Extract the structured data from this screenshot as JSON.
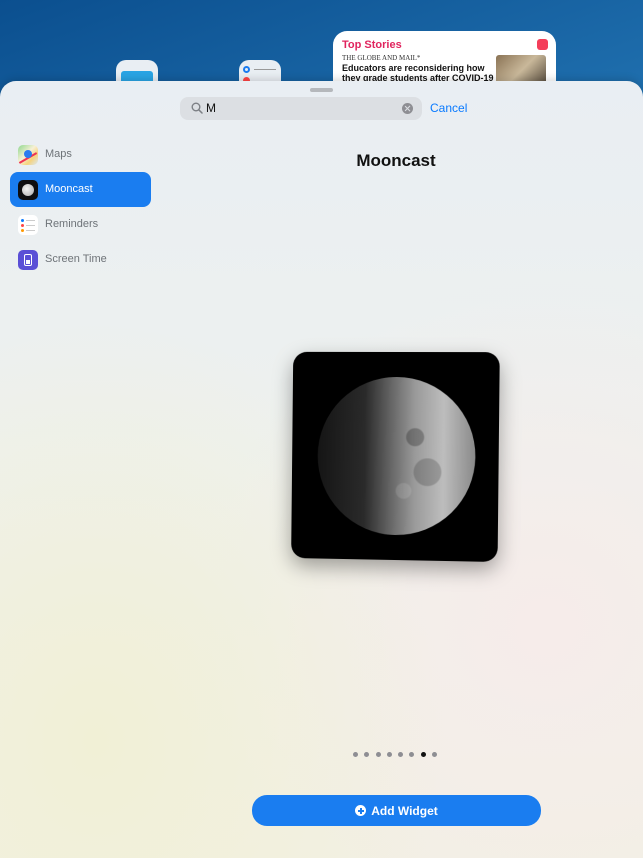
{
  "background": {
    "news_widget": {
      "title": "Top Stories",
      "source": "THE GLOBE AND MAIL*",
      "headline": "Educators are reconsidering how they grade students after COVID-19"
    }
  },
  "search": {
    "query": "M",
    "cancel_label": "Cancel"
  },
  "sidebar": {
    "items": [
      {
        "label": "Maps",
        "icon": "maps-icon",
        "selected": false
      },
      {
        "label": "Mooncast",
        "icon": "mooncast-icon",
        "selected": true
      },
      {
        "label": "Reminders",
        "icon": "reminders-icon",
        "selected": false
      },
      {
        "label": "Screen Time",
        "icon": "screen-time-icon",
        "selected": false
      }
    ]
  },
  "detail": {
    "app_name": "Mooncast",
    "widget_preview": "moon-phase-widget",
    "page_count": 8,
    "current_page": 7
  },
  "add_widget_label": "Add Widget",
  "colors": {
    "accent": "#1a7df0",
    "link": "#0a7aff"
  }
}
